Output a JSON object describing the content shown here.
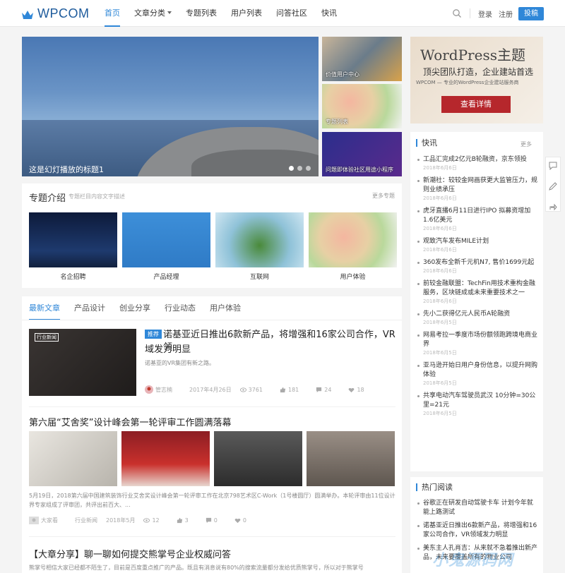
{
  "nav": {
    "logo": "WPCOM",
    "items": [
      {
        "label": "首页",
        "active": true
      },
      {
        "label": "文章分类",
        "dropdown": true
      },
      {
        "label": "专题列表"
      },
      {
        "label": "用户列表"
      },
      {
        "label": "问答社区"
      },
      {
        "label": "快讯"
      }
    ],
    "login": "登录",
    "register": "注册",
    "signup": "投稿"
  },
  "slider": {
    "caption": "这是幻灯播放的标题1",
    "thumbs": [
      "价值用户中心",
      "专题列表",
      "问题即体验社区用途小程序"
    ]
  },
  "ad": {
    "title": "WordPress主题",
    "subtitle": "顶尖团队打造，企业建站首选",
    "small": "WPCOM — 专业的WordPress企业建站服务商",
    "button": "查看详情"
  },
  "topics": {
    "title": "专题介绍",
    "desc": "专题栏目内容文字描述",
    "more": "更多专题",
    "items": [
      "名企招聘",
      "产品经理",
      "互联网",
      "用户体验"
    ]
  },
  "tabs": [
    "最新文章",
    "产品设计",
    "创业分享",
    "行业动态",
    "用户体验"
  ],
  "post1": {
    "tag": "推荐",
    "title": "诺基亚近日推出6款新产品，将增强和16家公司合作，VR领",
    "title2": "域发力明显",
    "excerpt": "诺基亚的VR集团有新之路。",
    "author": "管志楠",
    "date": "2017年4月26日",
    "views": "3761",
    "likes": "181",
    "comments": "24",
    "favs": "18",
    "thumb_label": "行业新闻"
  },
  "post2": {
    "title": "第六届“艾舍奖”设计峰会第一轮评审工作圆满落幕",
    "excerpt": "5月19日，2018第六届中国建筑装饰行业艾舍奖设计峰会第一轮评审工作在北京798艺术区C-Work（1号楼圆厅）圆满举办。本轮评审由11位设计界专家组成了评审团，共评出前百大、...",
    "author": "大家看",
    "category": "行业新闻",
    "date": "2018年5月",
    "views": "12",
    "likes": "3",
    "comments": "0",
    "favs": "0"
  },
  "post3": {
    "title": "【大章分享】聊一聊如何提交熊掌号企业权威问答",
    "excerpt": "熊掌号相信大家已经都不陌生了，目前是百度重点推广的产品。既且有消息说有80%的搜索流量都分发给优质熊掌号，所以对于熊掌号"
  },
  "news": {
    "title": "快讯",
    "more": "更多",
    "items": [
      {
        "t": "工品汇完成2亿元B轮融资，京东领投",
        "d": "2018年6月6日"
      },
      {
        "t": "新潮社：较较金网画获更大监管压力，规则业绩承压",
        "d": "2018年6月6日"
      },
      {
        "t": "虎牙直播6月11日进行IPO 拟募资增加1.6亿美元",
        "d": "2018年6月6日"
      },
      {
        "t": "观致汽车发布MILE计划",
        "d": "2018年6月6日"
      },
      {
        "t": "360发布全新千元机N7, 售价1699元起",
        "d": "2018年6月6日"
      },
      {
        "t": "前较金融联盟：TechFin用技术重构金融服务，区块链成或未来重要技术之一",
        "d": "2018年6月6日"
      },
      {
        "t": "先小二获得亿元人民币A轮融资",
        "d": "2018年6月5日"
      },
      {
        "t": "网易考拉一季度市场份额领跑跨境电商业界",
        "d": "2018年6月5日"
      },
      {
        "t": "亚马逊开始日用户身份信息，以提升网购体验",
        "d": "2018年6月5日"
      },
      {
        "t": "共享电动汽车驾驶员武汉 10分钟=30公里=21元",
        "d": "2018年6月5日"
      }
    ]
  },
  "hot": {
    "title": "热门阅读",
    "items": [
      "谷歌正在研发自动驾驶卡车 计划今年就能上路测试",
      "诺基亚近日推出6款新产品，将增强和16家公司合作，VR领域发力明显",
      "美东主人孔肖吉：从来就不急着推出新产品，未来要覆盖所有的物业公司"
    ]
  },
  "watermark": "小鬼源码网"
}
